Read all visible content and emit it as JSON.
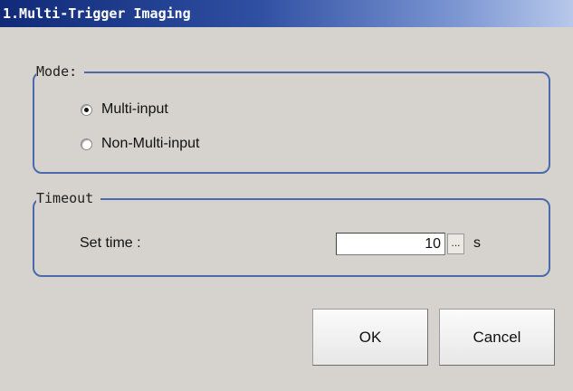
{
  "window": {
    "title": "1.Multi-Trigger Imaging"
  },
  "mode_group": {
    "legend": "Mode:",
    "options": [
      {
        "label": "Multi-input",
        "selected": true
      },
      {
        "label": "Non-Multi-input",
        "selected": false
      }
    ]
  },
  "timeout_group": {
    "legend": "Timeout",
    "set_time_label": "Set time :",
    "value": "10",
    "ellipsis_label": "...",
    "unit": "s"
  },
  "buttons": {
    "ok": "OK",
    "cancel": "Cancel"
  },
  "colors": {
    "title_bar_dark": "#102a78",
    "title_bar_light": "#b7c8ea",
    "group_border": "#4a6aab",
    "background": "#d6d3ce"
  },
  "icons": {
    "selected_radio": "radio-checked-icon",
    "unselected_radio": "radio-unchecked-icon"
  }
}
